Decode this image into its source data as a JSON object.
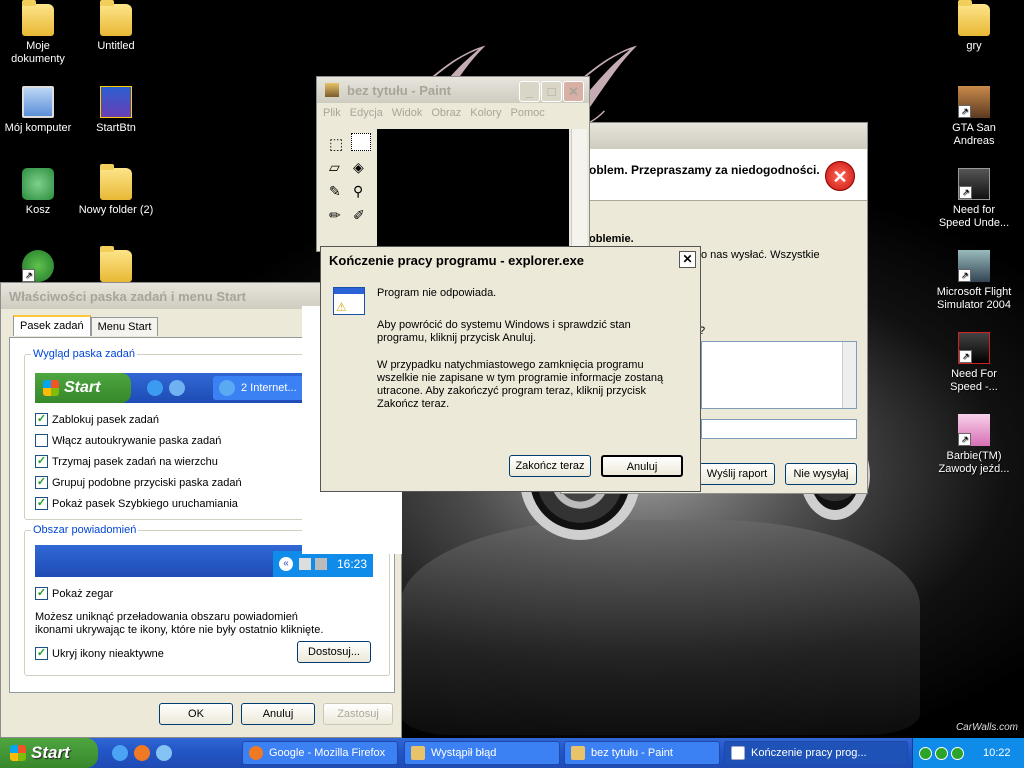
{
  "desktop": {
    "icons_left": [
      {
        "label": "Moje dokumenty",
        "icon": "my-documents-icon"
      },
      {
        "label": "Untitled",
        "icon": "folder-icon"
      },
      {
        "label": "Mój komputer",
        "icon": "my-computer-icon"
      },
      {
        "label": "StartBtn",
        "icon": "startbtn-icon"
      },
      {
        "label": "Kosz",
        "icon": "recycle-bin-icon"
      },
      {
        "label": "Nowy folder (2)",
        "icon": "folder-icon"
      }
    ],
    "icons_right": [
      {
        "label": "gry",
        "icon": "folder-icon"
      },
      {
        "label": "GTA San Andreas",
        "icon": "gta-icon"
      },
      {
        "label": "Need for Speed Unde...",
        "icon": "nfs-icon"
      },
      {
        "label": "Microsoft Flight Simulator 2004",
        "icon": "flight-sim-icon"
      },
      {
        "label": "Need For Speed -...",
        "icon": "nfs-icon"
      },
      {
        "label": "Barbie(TM) Zawody jeźd...",
        "icon": "barbie-icon"
      }
    ],
    "wallpaper_credit": "CarWalls.com"
  },
  "paint": {
    "title": "bez tytułu - Paint",
    "menu": [
      "Plik",
      "Edycja",
      "Widok",
      "Obraz",
      "Kolory",
      "Pomoc"
    ]
  },
  "error_dialog": {
    "header_text": "oblem. Przepraszamy za niedogodności.",
    "body1": "oblemie.",
    "body2": "o nas wysłać. Wszystkie",
    "question_mark": "?",
    "send_label": "Wyślij raport",
    "dont_send_label": "Nie wysyłaj"
  },
  "end_program": {
    "title": "Kończenie pracy programu - explorer.exe",
    "line1": "Program nie odpowiada.",
    "line2": "Aby powrócić do systemu Windows i sprawdzić stan programu, kliknij przycisk Anuluj.",
    "line3": "W przypadku natychmiastowego zamknięcia programu wszelkie nie zapisane w tym programie informacje zostaną utracone. Aby zakończyć program teraz, kliknij przycisk Zakończ teraz.",
    "end_now_label": "Zakończ teraz",
    "cancel_label": "Anuluj"
  },
  "taskbar_props": {
    "title": "Właściwości paska zadań i menu Start",
    "tabs": [
      "Pasek zadań",
      "Menu Start"
    ],
    "group1_label": "Wygląd paska zadań",
    "preview_start": "Start",
    "preview_task": "2 Internet...",
    "options": [
      {
        "label": "Zablokuj pasek zadań",
        "checked": true
      },
      {
        "label": "Włącz autoukrywanie paska zadań",
        "checked": false
      },
      {
        "label": "Trzymaj pasek zadań na wierzchu",
        "checked": true
      },
      {
        "label": "Grupuj podobne przyciski paska zadań",
        "checked": true
      },
      {
        "label": "Pokaż pasek Szybkiego uruchamiania",
        "checked": true
      }
    ],
    "group2_label": "Obszar powiadomień",
    "preview_clock": "16:23",
    "show_clock": "Pokaż zegar",
    "info_text": "Możesz uniknąć przeładowania obszaru powiadomień ikonami ukrywając te ikony, które nie były ostatnio kliknięte.",
    "hide_icons": "Ukryj ikony nieaktywne",
    "customize_label": "Dostosuj...",
    "ok_label": "OK",
    "cancel_label": "Anuluj",
    "apply_label": "Zastosuj"
  },
  "taskbar": {
    "start_label": "Start",
    "tasks": [
      {
        "label": "Google - Mozilla Firefox",
        "active": false
      },
      {
        "label": "Wystąpił błąd",
        "active": false
      },
      {
        "label": "bez tytułu - Paint",
        "active": false
      },
      {
        "label": "Kończenie pracy prog...",
        "active": true
      }
    ],
    "clock": "10:22"
  }
}
